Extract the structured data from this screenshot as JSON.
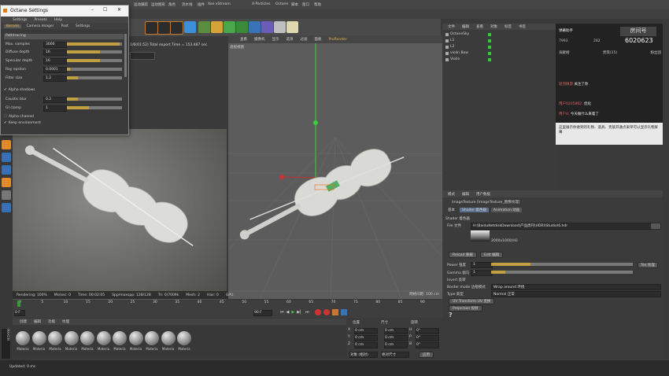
{
  "menubar": {
    "items": [
      "运动跟踪",
      "运动图形",
      "角色",
      "流水线",
      "插件",
      "Xee xStream",
      "X-Particles",
      "Octane",
      "脚本",
      "窗口",
      "帮助"
    ]
  },
  "octane": {
    "title": "Octane Settings",
    "menu": [
      "Settings",
      "Presets",
      "Help"
    ],
    "tabs": [
      "Kernels",
      "Camera Imager",
      "Post",
      "Settings"
    ],
    "mode": "Pathtracing",
    "params": [
      {
        "label": "Max. samples",
        "value": "3000",
        "fill": 0.95
      },
      {
        "label": "Diffuse depth",
        "value": "16",
        "fill": 0.6
      },
      {
        "label": "Specular depth",
        "value": "16",
        "fill": 0.6
      },
      {
        "label": "Ray epsilon",
        "value": "0.0001",
        "fill": 0.05
      },
      {
        "label": "Filter size",
        "value": "1.2",
        "fill": 0.2
      },
      {
        "label": "Caustic blur",
        "value": "0.2",
        "fill": 0.2
      },
      {
        "label": "GI clamp",
        "value": "1",
        "fill": 0.4
      }
    ],
    "checks": [
      "Alpha shadows",
      "Alpha channel",
      "Keep environment"
    ]
  },
  "viewport1": {
    "export_time": "1/6(01:52) Total export Time = 153.487 sec",
    "status": [
      "Rendering: 100%",
      "Ms/sec: 0",
      "Time: 00:02:05",
      "Spp/maxspp: 128/128",
      "Tri: 0/7009k",
      "Mesh: 2",
      "Hair: 0",
      "GPU:"
    ]
  },
  "viewport2": {
    "menus": [
      "查看",
      "摄像机",
      "显示",
      "选项",
      "过滤",
      "面板",
      "ProRender"
    ],
    "label": "透视视图",
    "grid": "网格间距: 100 cm"
  },
  "objects": {
    "header": [
      "文件",
      "编辑",
      "查看",
      "对象",
      "标签",
      "书签"
    ],
    "items": [
      "OctaneSky",
      "L1",
      "L2",
      "violin Bow",
      "Violin"
    ]
  },
  "chat": {
    "title": "弹幕助手",
    "stats": [
      "7993",
      "282"
    ],
    "big_number": "6020623",
    "tabs": [
      "贡献榜",
      "贵宾(15)",
      "粉丝团"
    ],
    "messages": [
      {
        "user": "轻羽微游",
        "text": "关注了你"
      },
      {
        "user": "用户0205862:",
        "text": "优化"
      },
      {
        "user": "用户4:",
        "text": "今天做什么来着了"
      }
    ],
    "notice": "这里展示你收到的礼物、道具、贵族开通点采单可以显示礼物屏幕",
    "watermark": "房间号"
  },
  "attributes": {
    "menus": [
      "模式",
      "编辑",
      "用户数据"
    ],
    "object_title": "ImageTexture [ImageTexture_图像纹理]",
    "tabs": [
      "基本",
      "Shader 着色器",
      "Animation 动画"
    ],
    "section": "Shader 着色器",
    "file_label": "File 文件",
    "file_path": "H:\\BaiduNetdiskDownload\\产品周刊\\HDRI\\Studio\\6.hdr",
    "preview_size": "2000x1000(Hi)",
    "buttons": [
      "Reload 重载",
      "Edit 编辑"
    ],
    "power": {
      "label": "Power 强度",
      "value": "1",
      "fill": 0.28
    },
    "gamma": {
      "label": "Gamma 伽马",
      "value": "1",
      "fill": 0.1
    },
    "tex_button": "Tex 纹理",
    "invert": "Invert 反转",
    "border": {
      "label": "Border mode 边框模式",
      "value": "Wrap around 环绕"
    },
    "type": {
      "label": "Type 类型",
      "value": "Normal 正常"
    },
    "uv": "UV Transform UV 变换",
    "projection": "Projection 投射"
  },
  "timeline": {
    "ticks": [
      "0",
      "5",
      "10",
      "15",
      "20",
      "25",
      "30",
      "35",
      "40",
      "45",
      "50",
      "55",
      "60",
      "65",
      "70",
      "75",
      "80",
      "85",
      "90"
    ],
    "start": "0 F",
    "end": "90 F"
  },
  "materials": {
    "menus": [
      "创建",
      "编辑",
      "功能",
      "纹理"
    ],
    "label": "Materia",
    "count": 11
  },
  "coords": {
    "headers": [
      "位置",
      "尺寸",
      "旋转"
    ],
    "rows": [
      [
        "X",
        "0 cm",
        "0 cm",
        "H",
        "0°"
      ],
      [
        "Y",
        "0 cm",
        "0 cm",
        "P",
        "0°"
      ],
      [
        "Z",
        "0 cm",
        "0 cm",
        "B",
        "0°"
      ]
    ],
    "dropdowns": [
      "对象 (相对)",
      "绝对尺寸"
    ],
    "apply": "应用"
  },
  "statusbar": {
    "text": "Updated: 0 ms"
  },
  "colors": {
    "accent": "#c0a040",
    "selection": "#5a6f8c"
  }
}
